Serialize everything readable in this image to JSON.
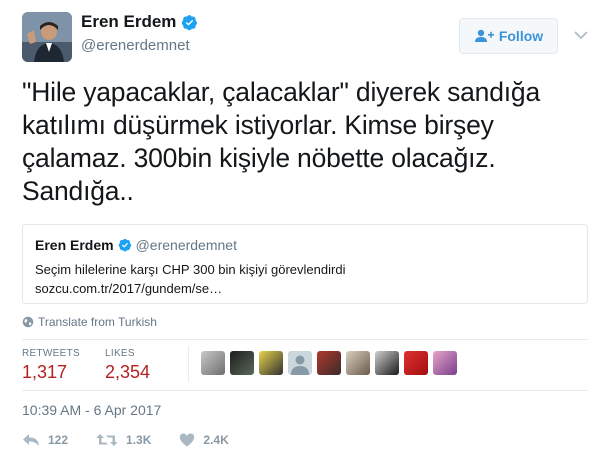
{
  "author": {
    "name": "Eren Erdem",
    "handle": "@erenerdemnet"
  },
  "follow_button": {
    "label": "Follow"
  },
  "tweet": {
    "line1": "\"Hile yapacaklar, çalacaklar\" diyerek sandığa",
    "line2": "katılımı düşürmek istiyorlar. Kimse birşey",
    "line3": "çalamaz. 300bin kişiyle nöbette olacağız.",
    "line4": "Sandığa.."
  },
  "quoted_tweet": {
    "name": "Eren Erdem",
    "handle": "@erenerdemnet",
    "text": "Seçim hilelerine karşı CHP 300 bin kişiyi görevlendirdi",
    "link": "sozcu.com.tr/2017/gundem/se…"
  },
  "translate": {
    "label": "Translate from Turkish"
  },
  "stats": {
    "retweets_label": "RETWEETS",
    "retweets_value": "1,317",
    "likes_label": "LIKES",
    "likes_value": "2,354"
  },
  "timestamp": "10:39 AM - 6 Apr 2017",
  "actions": {
    "reply_count": "122",
    "retweet_count": "1.3K",
    "like_count": "2.4K"
  },
  "colors": {
    "accent": "#1da1f2",
    "stat_value": "#b22222",
    "muted": "#657786"
  }
}
